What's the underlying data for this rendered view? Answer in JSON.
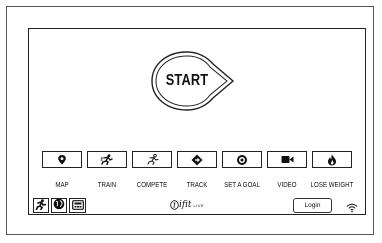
{
  "start": {
    "label": "START"
  },
  "tiles": [
    {
      "label": "MAP",
      "icon": "map-pin-icon"
    },
    {
      "label": "TRAIN",
      "icon": "runner-icon"
    },
    {
      "label": "COMPETE",
      "icon": "sprinter-icon"
    },
    {
      "label": "TRACK",
      "icon": "track-icon"
    },
    {
      "label": "SET A GOAL",
      "icon": "target-icon"
    },
    {
      "label": "VIDEO",
      "icon": "video-camera-icon"
    },
    {
      "label": "LOSE WEIGHT",
      "icon": "flame-icon"
    }
  ],
  "bottom_bar": {
    "icons": [
      "runner-profile-icon",
      "globe-icon",
      "console-display-icon"
    ],
    "logo_main": "ifit",
    "logo_sub": "LIVE",
    "login_label": "Login",
    "wifi_icon": "wifi-icon"
  }
}
